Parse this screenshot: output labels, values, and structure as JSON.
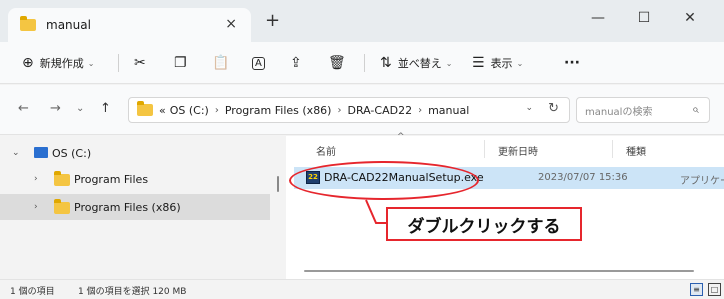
{
  "tab": {
    "title": "manual",
    "close": "×",
    "new": "+"
  },
  "window": {
    "minimize": "—",
    "maximize": "☐",
    "close": "✕"
  },
  "toolbar": {
    "new_label": "新規作成",
    "new_icon": "⊕",
    "cut_icon": "✂",
    "copy_icon": "❐",
    "paste_icon": "📋",
    "rename_icon": "A",
    "share_icon": "⇪",
    "delete_icon": "🗑",
    "sort_icon": "⇅",
    "sort_label": "並べ替え",
    "view_icon": "☰",
    "view_label": "表示",
    "more": "···",
    "chevron": "⌄"
  },
  "nav": {
    "back": "←",
    "forward": "→",
    "recent": "⌄",
    "up": "↑"
  },
  "address": {
    "overflow": "«",
    "crumbs": [
      "OS (C:)",
      "Program Files (x86)",
      "DRA-CAD22",
      "manual"
    ],
    "separator": "›",
    "dropdown": "⌄",
    "refresh": "↻"
  },
  "search": {
    "placeholder": "manualの検索",
    "icon": "⌕"
  },
  "navpane": {
    "items": [
      {
        "label": "OS (C:)",
        "expander": "⌄"
      },
      {
        "label": "Program Files",
        "expander": "›"
      },
      {
        "label": "Program Files (x86)",
        "expander": "›"
      }
    ]
  },
  "columns": {
    "name": "名前",
    "date": "更新日時",
    "type": "種類",
    "sort_caret": "^"
  },
  "file": {
    "name": "DRA-CAD22ManualSetup.exe",
    "date": "2023/07/07 15:36",
    "type": "アプリケーション",
    "icon_text": "22"
  },
  "annotation": {
    "text": "ダブルクリックする",
    "color": "#e6262d"
  },
  "status": {
    "count": "1 個の項目",
    "selection": "1 個の項目を選択 120 MB",
    "details_icon": "≡",
    "tiles_icon": "□"
  }
}
